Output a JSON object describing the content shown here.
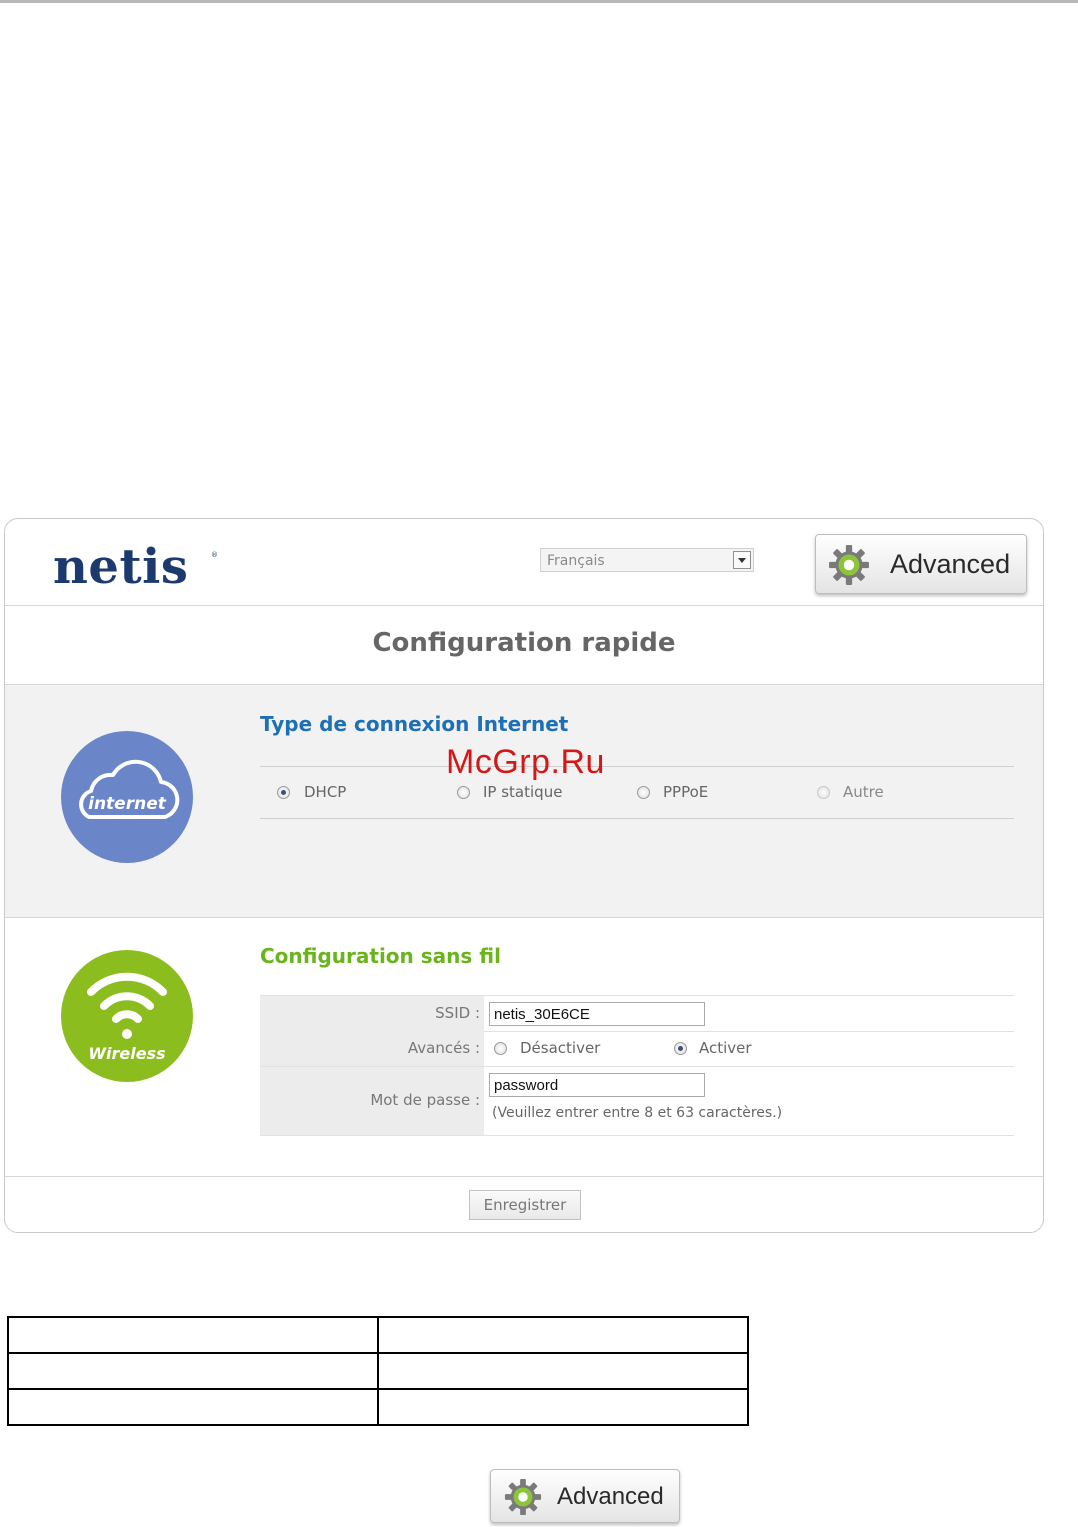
{
  "panel": {
    "logo": "netis",
    "logo_mark": "®",
    "language": {
      "selected": "Français"
    },
    "advanced_button": "Advanced",
    "page_title": "Configuration rapide",
    "internet": {
      "icon_label": "internet",
      "title": "Type de connexion Internet",
      "options": [
        {
          "label": "DHCP",
          "checked": true
        },
        {
          "label": "IP statique",
          "checked": false
        },
        {
          "label": "PPPoE",
          "checked": false
        },
        {
          "label": "Autre",
          "checked": false,
          "disabled": true
        }
      ]
    },
    "wireless": {
      "icon_label": "Wireless",
      "title": "Configuration sans fil",
      "ssid_label": "SSID :",
      "ssid_value": "netis_30E6CE",
      "advanced_label": "Avancés :",
      "advanced_options": [
        {
          "label": "Désactiver",
          "checked": false
        },
        {
          "label": "Activer",
          "checked": true
        }
      ],
      "password_label": "Mot de passe :",
      "password_value": "password",
      "password_hint": "(Veuillez entrer entre 8 et 63 caractères.)"
    },
    "save_button": "Enregistrer"
  },
  "watermark": "McGrp.Ru",
  "bottom_table": {
    "rows": [
      [
        "",
        ""
      ],
      [
        "",
        ""
      ],
      [
        "",
        ""
      ]
    ]
  },
  "bottom_button": "Advanced",
  "colors": {
    "brand": "#1d3a6e",
    "internet_accent": "#1f6fb5",
    "internet_circle": "#6b86c8",
    "wireless_accent": "#6ab41d",
    "wireless_circle": "#8cbd1f",
    "watermark": "#d41818"
  }
}
